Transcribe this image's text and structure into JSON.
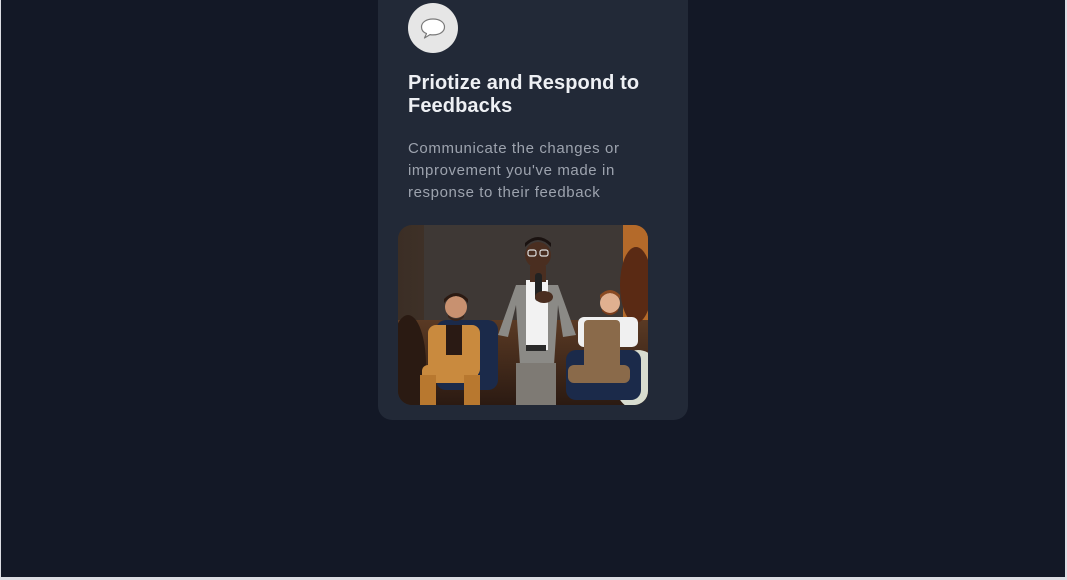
{
  "card": {
    "icon": "speech-bubble-icon",
    "title": "Priotize and Respond to Feedbacks",
    "description": "Communicate the changes or improvement you've made in response to their feedback",
    "image": "panel-speaker-photo"
  },
  "colors": {
    "page_background": "#131826",
    "card_background": "#222937",
    "icon_background": "#e6e6e6",
    "title_color": "#eef0f4",
    "description_color": "#9da3ae"
  }
}
